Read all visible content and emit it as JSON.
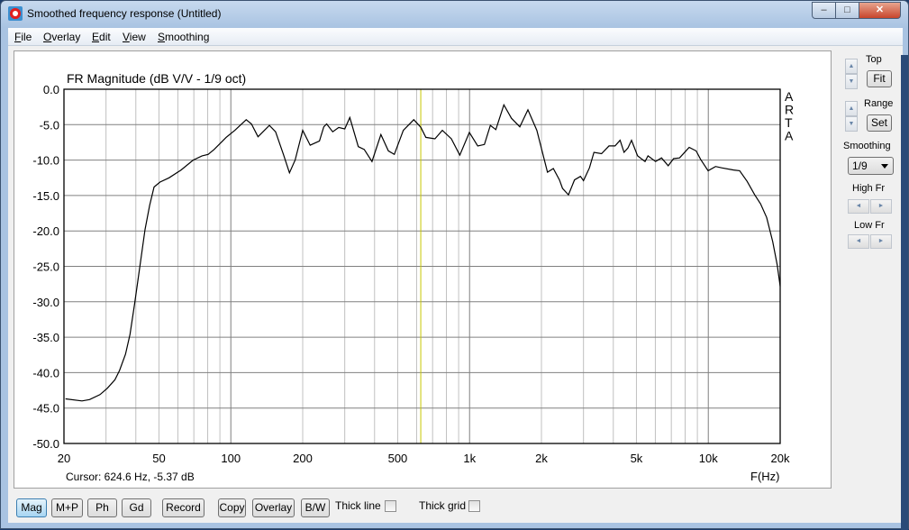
{
  "window": {
    "title": "Smoothed frequency response (Untitled)",
    "min": "–",
    "max": "□",
    "close": "✕"
  },
  "menu": [
    {
      "label": "File",
      "u": "F",
      "rest": "ile"
    },
    {
      "label": "Overlay",
      "u": "O",
      "rest": "verlay"
    },
    {
      "label": "Edit",
      "u": "E",
      "rest": "dit"
    },
    {
      "label": "View",
      "u": "V",
      "rest": "iew"
    },
    {
      "label": "Smoothing",
      "u": "S",
      "rest": "moothing"
    }
  ],
  "side": {
    "top_label": "Top",
    "fit": "Fit",
    "range_label": "Range",
    "set": "Set",
    "smoothing_label": "Smoothing",
    "smoothing_value": "1/9",
    "high_fr": "High Fr",
    "low_fr": "Low Fr",
    "up": "▲",
    "down": "▼",
    "left": "◄",
    "right": "►"
  },
  "toolbar": {
    "mag": "Mag",
    "mp": "M+P",
    "ph": "Ph",
    "gd": "Gd",
    "record": "Record",
    "copy": "Copy",
    "overlay": "Overlay",
    "bw": "B/W",
    "thick_line": "Thick line",
    "thick_grid": "Thick grid",
    "thick_line_checked": false,
    "thick_grid_checked": false
  },
  "colors": {
    "curve": "#000000",
    "cursor": "#c8c800",
    "grid_major": "#808080",
    "grid_minor": "#c0c0c0"
  },
  "chart_data": {
    "type": "line",
    "title": "FR Magnitude (dB V/V - 1/9 oct)",
    "xlabel": "F(Hz)",
    "ylabel": "",
    "xscale": "log",
    "xlim": [
      20,
      20000
    ],
    "ylim": [
      -50,
      0
    ],
    "grid": true,
    "watermark": "ARTA",
    "cursor": {
      "freq": 624.6,
      "text": "Cursor: 624.6 Hz, -5.37 dB"
    },
    "yticks": [
      0,
      -5,
      -10,
      -15,
      -20,
      -25,
      -30,
      -35,
      -40,
      -45,
      -50
    ],
    "ytick_labels": [
      "0.0",
      "-5.0",
      "-10.0",
      "-15.0",
      "-20.0",
      "-25.0",
      "-30.0",
      "-35.0",
      "-40.0",
      "-45.0",
      "-50.0"
    ],
    "xticks": [
      20,
      50,
      100,
      200,
      500,
      1000,
      2000,
      5000,
      10000,
      20000
    ],
    "xtick_labels": [
      "20",
      "50",
      "100",
      "200",
      "500",
      "1k",
      "2k",
      "5k",
      "10k",
      "20k"
    ],
    "series": [
      {
        "name": "FR Magnitude",
        "x": [
          20.3,
          23.8,
          25.6,
          28.3,
          30.4,
          32.7,
          34.2,
          36.2,
          37.8,
          39.5,
          41.3,
          42.5,
          43.7,
          45.7,
          47.7,
          50.5,
          55.1,
          61.9,
          69.5,
          75.8,
          80.3,
          85.1,
          95.6,
          104,
          116,
          122,
          130,
          145,
          154,
          166,
          176,
          186,
          200,
          215,
          235,
          245,
          252,
          267,
          283,
          300,
          315,
          342,
          362,
          390,
          425,
          457,
          484,
          528,
          584,
          625,
          656,
          716,
          769,
          839,
          910,
          998,
          1082,
          1154,
          1222,
          1288,
          1392,
          1498,
          1624,
          1756,
          1914,
          2120,
          2244,
          2380,
          2450,
          2596,
          2750,
          2914,
          3000,
          3178,
          3320,
          3570,
          3838,
          4068,
          4270,
          4436,
          4606,
          4768,
          5054,
          5432,
          5590,
          6012,
          6368,
          6792,
          7156,
          7578,
          8316,
          8892,
          9288,
          9980,
          10726,
          11370,
          12764,
          13530,
          14540,
          15640,
          16560,
          17560,
          18610,
          19430,
          20000
        ],
        "y": [
          -43.7,
          -44.0,
          -43.8,
          -43.1,
          -42.2,
          -41.0,
          -39.7,
          -37.4,
          -34.6,
          -30.4,
          -25.7,
          -22.7,
          -19.8,
          -16.4,
          -13.8,
          -13.1,
          -12.5,
          -11.4,
          -10.0,
          -9.4,
          -9.2,
          -8.5,
          -6.8,
          -5.8,
          -4.3,
          -4.9,
          -6.7,
          -5.1,
          -6.0,
          -9.2,
          -11.8,
          -10.0,
          -5.8,
          -7.9,
          -7.3,
          -5.3,
          -4.9,
          -6.0,
          -5.4,
          -5.6,
          -4.0,
          -8.1,
          -8.5,
          -10.2,
          -6.4,
          -8.7,
          -9.2,
          -5.8,
          -4.3,
          -5.37,
          -6.8,
          -7.0,
          -5.8,
          -7.0,
          -9.3,
          -6.1,
          -8.0,
          -7.8,
          -5.1,
          -5.7,
          -2.2,
          -4.1,
          -5.3,
          -2.9,
          -5.8,
          -11.7,
          -11.2,
          -12.8,
          -14.0,
          -14.9,
          -12.8,
          -12.3,
          -12.9,
          -11.1,
          -8.9,
          -9.1,
          -8.0,
          -8.0,
          -7.2,
          -8.9,
          -8.3,
          -7.2,
          -9.4,
          -10.2,
          -9.4,
          -10.2,
          -9.7,
          -10.8,
          -9.8,
          -9.7,
          -8.2,
          -8.7,
          -9.9,
          -11.5,
          -10.9,
          -11.1,
          -11.4,
          -11.5,
          -13.0,
          -14.9,
          -16.2,
          -18.1,
          -21.5,
          -24.8,
          -27.8
        ]
      }
    ]
  }
}
